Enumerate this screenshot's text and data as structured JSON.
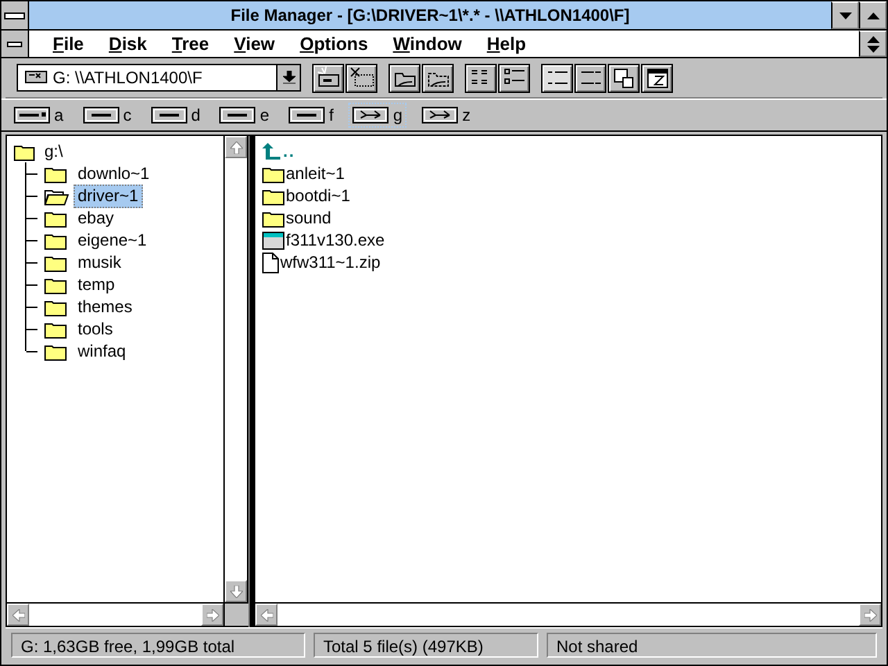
{
  "window": {
    "title": "File Manager - [G:\\DRIVER~1\\*.* - \\\\ATHLON1400\\F]"
  },
  "menu": [
    "File",
    "Disk",
    "Tree",
    "View",
    "Options",
    "Window",
    "Help"
  ],
  "drive_select": {
    "value": "G: \\\\ATHLON1400\\F"
  },
  "drives": [
    {
      "label": "a",
      "kind": "floppy",
      "selected": false
    },
    {
      "label": "c",
      "kind": "hard",
      "selected": false
    },
    {
      "label": "d",
      "kind": "hard",
      "selected": false
    },
    {
      "label": "e",
      "kind": "hard",
      "selected": false
    },
    {
      "label": "f",
      "kind": "hard",
      "selected": false
    },
    {
      "label": "g",
      "kind": "network",
      "selected": true
    },
    {
      "label": "z",
      "kind": "network",
      "selected": false
    }
  ],
  "tree": {
    "name": "g:\\",
    "selected": false,
    "children": [
      {
        "name": "downlo~1",
        "selected": false
      },
      {
        "name": "driver~1",
        "selected": true
      },
      {
        "name": "ebay",
        "selected": false
      },
      {
        "name": "eigene~1",
        "selected": false
      },
      {
        "name": "musik",
        "selected": false
      },
      {
        "name": "temp",
        "selected": false
      },
      {
        "name": "themes",
        "selected": false
      },
      {
        "name": "tools",
        "selected": false
      },
      {
        "name": "winfaq",
        "selected": false
      }
    ]
  },
  "files": [
    {
      "name": "..",
      "kind": "up"
    },
    {
      "name": "anleit~1",
      "kind": "folder"
    },
    {
      "name": "bootdi~1",
      "kind": "folder"
    },
    {
      "name": "sound",
      "kind": "folder"
    },
    {
      "name": "f311v130.exe",
      "kind": "program"
    },
    {
      "name": "wfw311~1.zip",
      "kind": "document"
    }
  ],
  "status_bar": [
    "G: 1,63GB free,  1,99GB total",
    "Total 5 file(s) (497KB)",
    "Not shared"
  ]
}
